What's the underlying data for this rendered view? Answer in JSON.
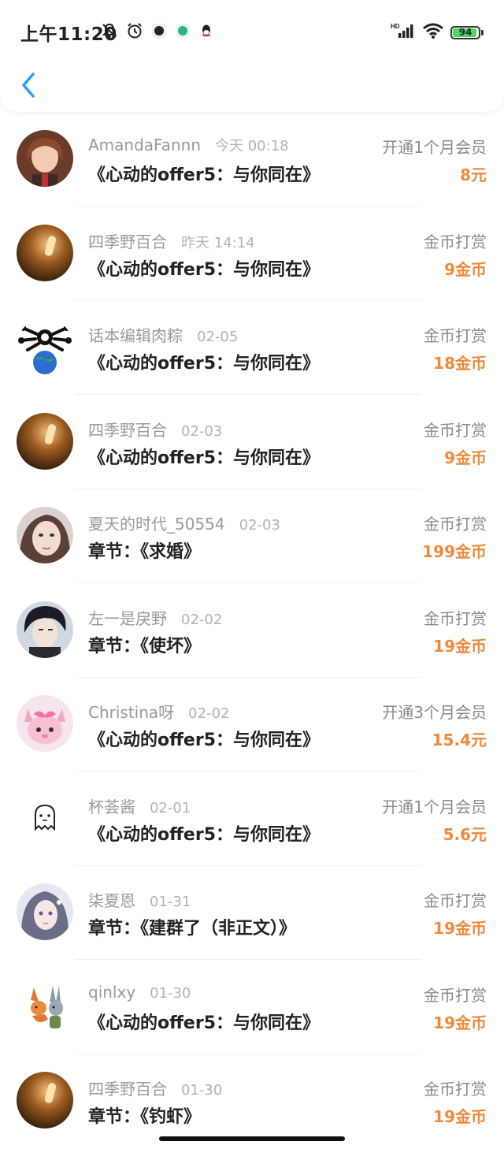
{
  "status_bar": {
    "time": "上午11:20",
    "battery": "94",
    "battery_level": 0.94,
    "icons_left": [
      "mute-icon",
      "alarm-icon",
      "app-icon",
      "app-icon",
      "qq-icon"
    ],
    "icons_right": [
      "signal-icon",
      "wifi-icon",
      "battery-icon"
    ]
  },
  "header": {
    "back_icon": "chevron-left-icon",
    "accent_color": "#2f9bff"
  },
  "colors": {
    "amount": "#f08a3c",
    "primary_text": "#222222",
    "secondary_text": "#9a9a9a"
  },
  "records": [
    {
      "user": "AmandaFannn",
      "time": "今天 00:18",
      "title": "《心动的offer5：与你同在》",
      "type": "开通1个月会员",
      "amount": "8元"
    },
    {
      "user": "四季野百合",
      "time": "昨天 14:14",
      "title": "《心动的offer5：与你同在》",
      "type": "金币打赏",
      "amount": "9金币"
    },
    {
      "user": "话本编辑肉粽",
      "time": "02-05",
      "title": "《心动的offer5：与你同在》",
      "type": "金币打赏",
      "amount": "18金币"
    },
    {
      "user": "四季野百合",
      "time": "02-03",
      "title": "《心动的offer5：与你同在》",
      "type": "金币打赏",
      "amount": "9金币"
    },
    {
      "user": "夏天的时代_50554",
      "time": "02-03",
      "title": "章节：《求婚》",
      "type": "金币打赏",
      "amount": "199金币"
    },
    {
      "user": "左一是戾野",
      "time": "02-02",
      "title": "章节：《使坏》",
      "type": "金币打赏",
      "amount": "19金币"
    },
    {
      "user": "Christina呀",
      "time": "02-02",
      "title": "《心动的offer5：与你同在》",
      "type": "开通3个月会员",
      "amount": "15.4元"
    },
    {
      "user": "杯荟酱",
      "time": "02-01",
      "title": "《心动的offer5：与你同在》",
      "type": "开通1个月会员",
      "amount": "5.6元"
    },
    {
      "user": "柒夏恩",
      "time": "01-31",
      "title": "章节：《建群了（非正文）》",
      "type": "金币打赏",
      "amount": "19金币"
    },
    {
      "user": "qinlxy",
      "time": "01-30",
      "title": "《心动的offer5：与你同在》",
      "type": "金币打赏",
      "amount": "19金币"
    },
    {
      "user": "四季野百合",
      "time": "01-30",
      "title": "章节：《钓虾》",
      "type": "金币打赏",
      "amount": "19金币"
    }
  ]
}
